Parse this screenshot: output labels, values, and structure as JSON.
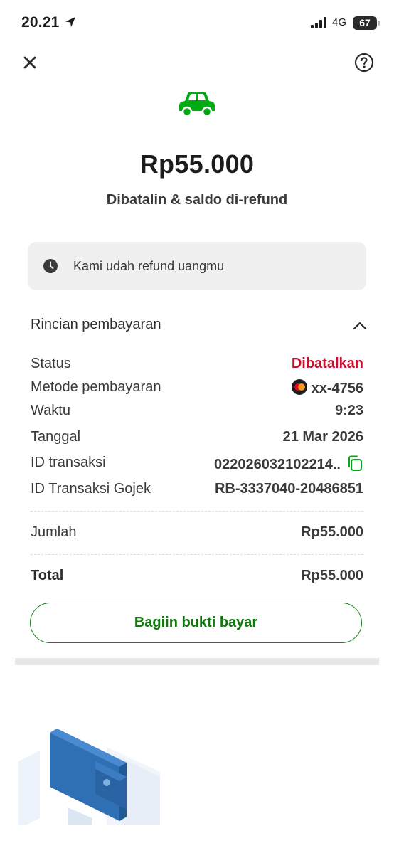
{
  "status_bar": {
    "time": "20.21",
    "network": "4G",
    "battery": "67"
  },
  "header": {
    "close_icon": "close-icon",
    "help_icon": "help-icon"
  },
  "transaction": {
    "service_icon": "car-icon",
    "amount": "Rp55.000",
    "status_text": "Dibatalin & saldo di-refund"
  },
  "notice": {
    "text": "Kami udah refund uangmu",
    "icon": "clock-icon"
  },
  "details": {
    "title": "Rincian pembayaran",
    "rows": [
      {
        "label": "Status",
        "value": "Dibatalkan"
      },
      {
        "label": "Metode pembayaran",
        "value": "xx-4756"
      },
      {
        "label": "Waktu",
        "value": "9:23"
      },
      {
        "label": "Tanggal",
        "value": "21 Mar 2026"
      },
      {
        "label": "ID transaksi",
        "value": "022026032102214.."
      },
      {
        "label": "ID Transaksi Gojek",
        "value": "RB-3337040-20486851"
      }
    ],
    "amount_label": "Jumlah",
    "amount_value": "Rp55.000",
    "total_label": "Total",
    "total_value": "Rp55.000"
  },
  "share_button": {
    "label": "Bagiin bukti bayar"
  },
  "colors": {
    "green": "#00aa13",
    "red": "#c8102e",
    "blue": "#2f6fb3"
  }
}
